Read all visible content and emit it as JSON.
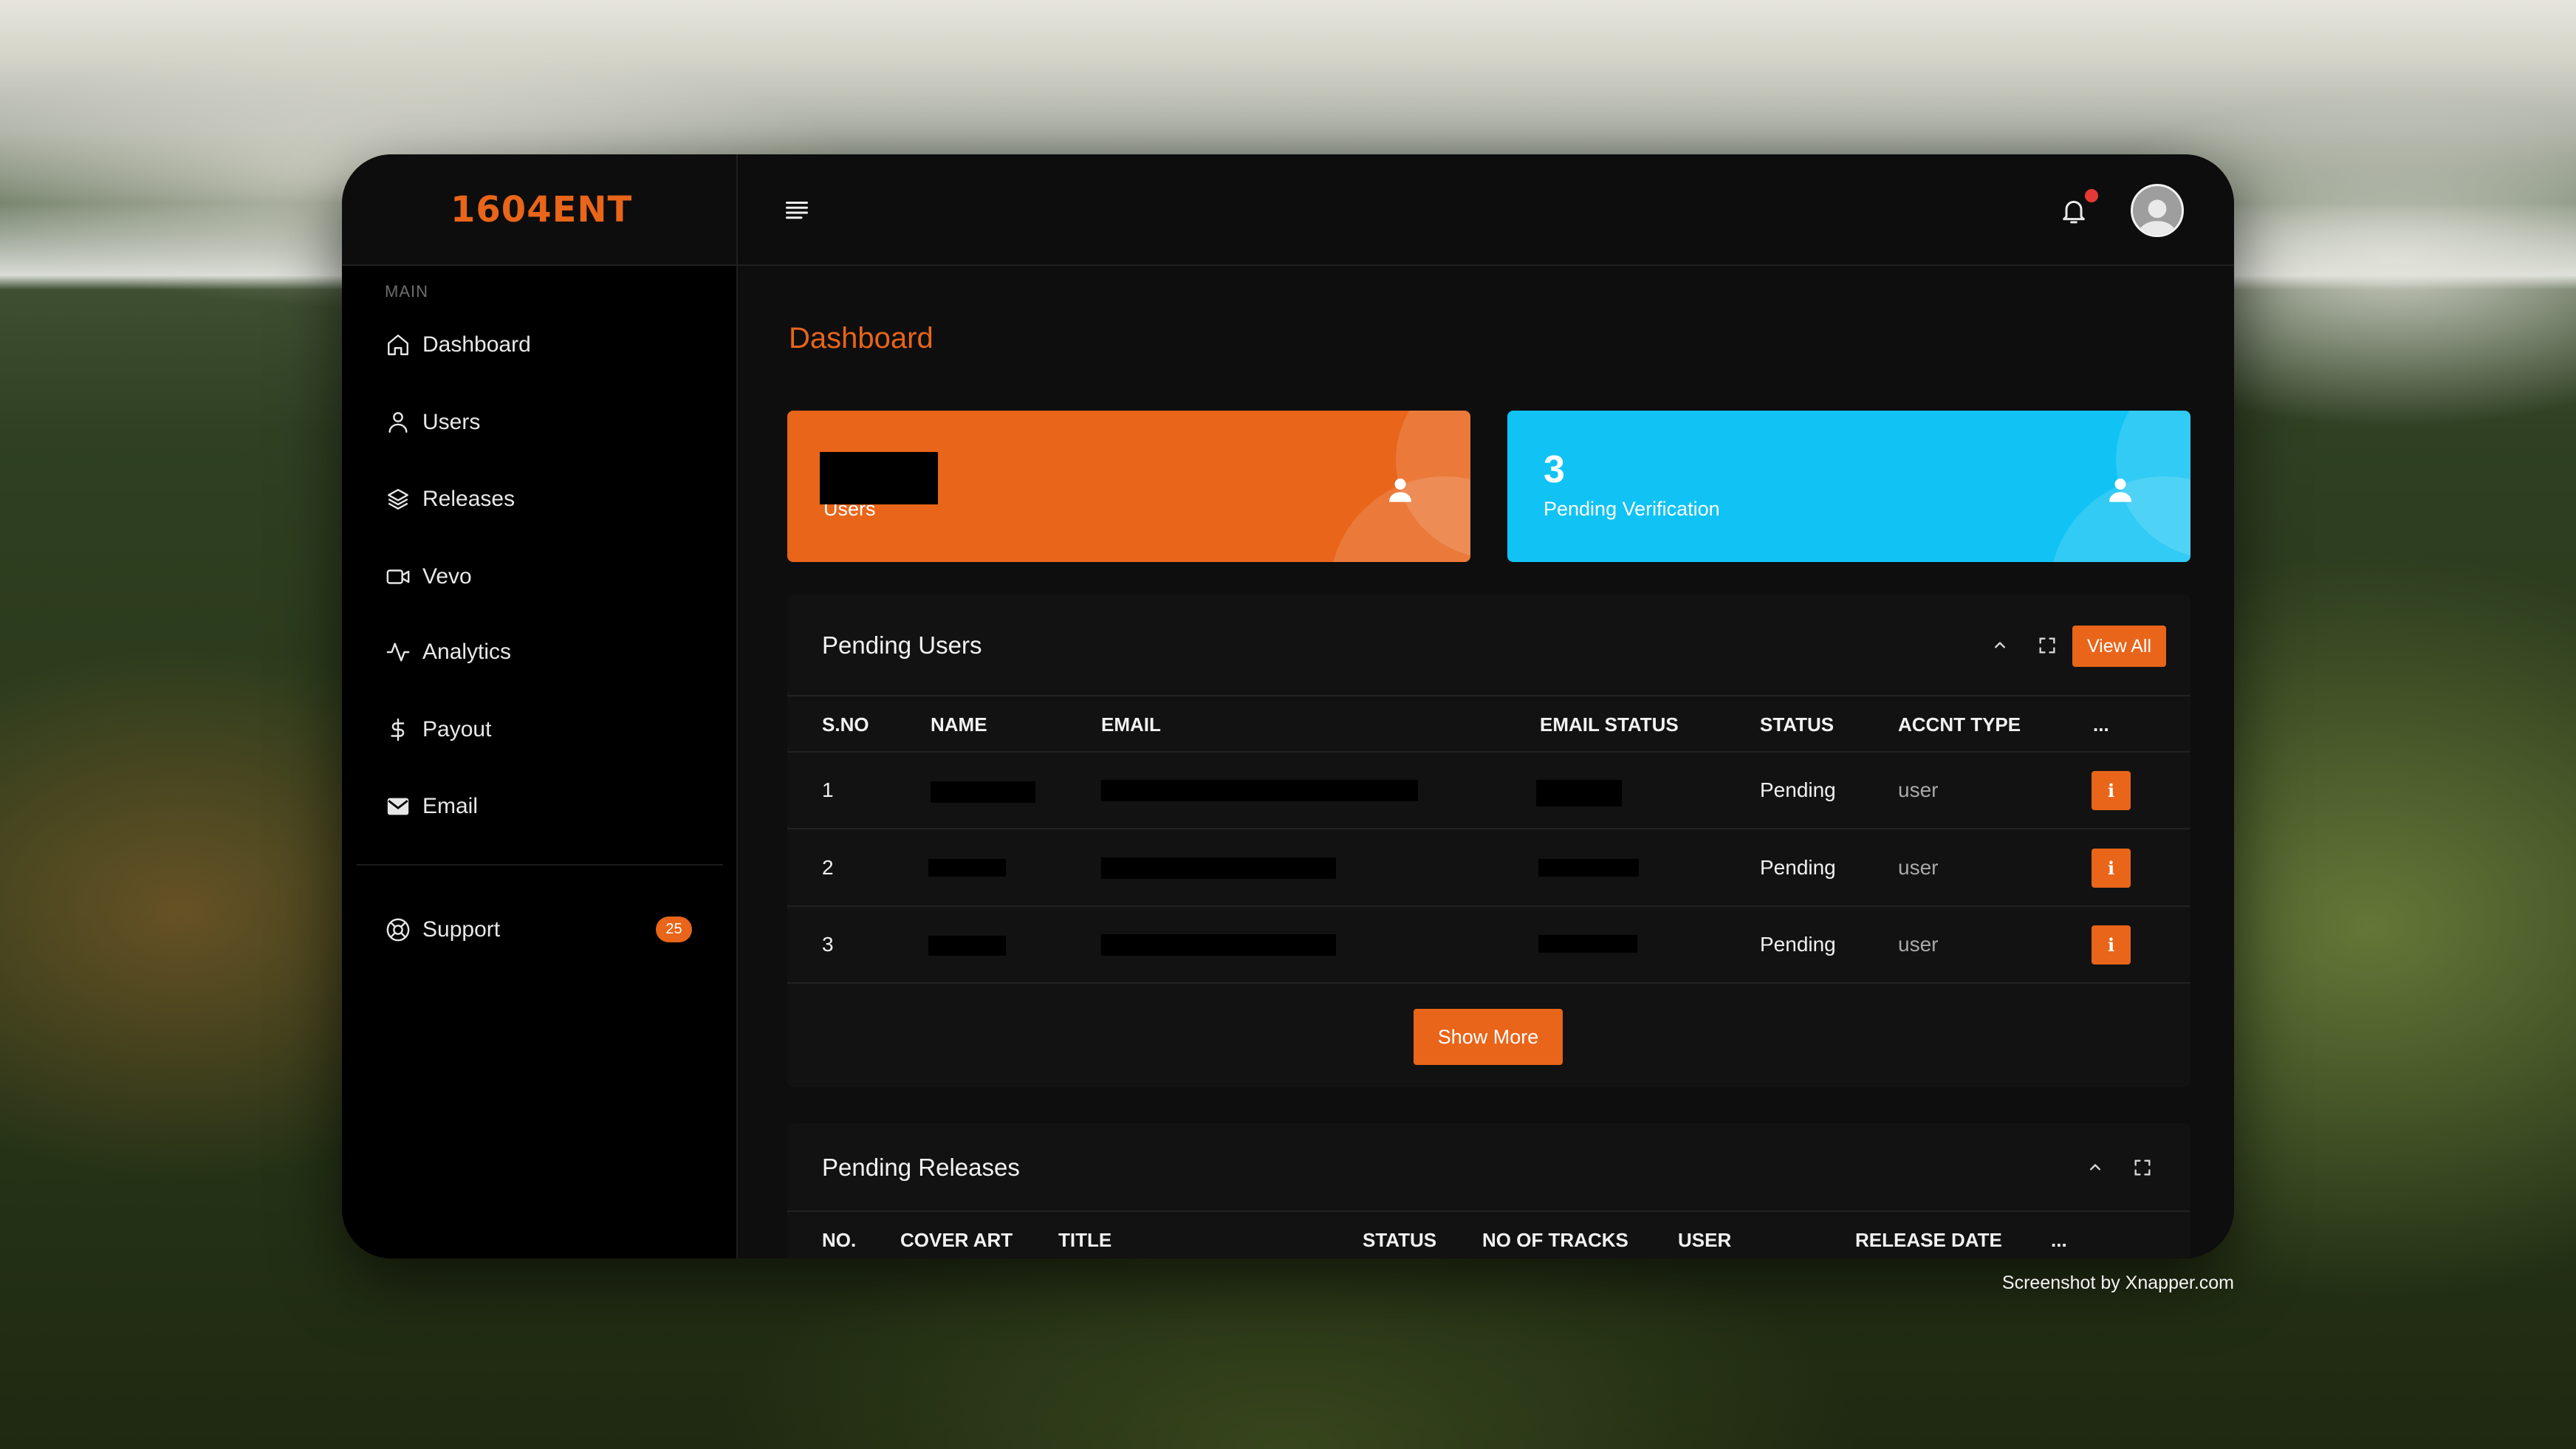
{
  "brand": {
    "logo": "1604ENT"
  },
  "header": {
    "menu_icon": "hamburger-icon",
    "notification_icon": "bell-icon",
    "profile_icon": "avatar-icon"
  },
  "sidebar": {
    "section_label": "MAIN",
    "items": [
      {
        "label": "Dashboard",
        "icon": "home-icon"
      },
      {
        "label": "Users",
        "icon": "user-icon"
      },
      {
        "label": "Releases",
        "icon": "layers-icon"
      },
      {
        "label": "Vevo",
        "icon": "video-icon"
      },
      {
        "label": "Analytics",
        "icon": "activity-icon"
      },
      {
        "label": "Payout",
        "icon": "dollar-icon"
      },
      {
        "label": "Email",
        "icon": "envelope-icon"
      }
    ],
    "support": {
      "label": "Support",
      "badge": "25",
      "icon": "lifebuoy-icon"
    }
  },
  "page": {
    "title": "Dashboard"
  },
  "stats": [
    {
      "label": "Users",
      "icon": "user-icon",
      "color": "#e8651a"
    },
    {
      "value": "3",
      "label": "Pending Verification",
      "icon": "user-icon",
      "color": "#10c3f4"
    }
  ],
  "pending_users": {
    "title": "Pending Users",
    "view_all_label": "View All",
    "columns": [
      "S.NO",
      "NAME",
      "EMAIL",
      "EMAIL STATUS",
      "STATUS",
      "ACCNT TYPE",
      "..."
    ],
    "rows": [
      {
        "sno": "1",
        "status": "Pending",
        "type": "user"
      },
      {
        "sno": "2",
        "status": "Pending",
        "type": "user"
      },
      {
        "sno": "3",
        "status": "Pending",
        "type": "user"
      }
    ],
    "row_action_label": "i",
    "show_more_label": "Show More"
  },
  "pending_releases": {
    "title": "Pending Releases",
    "columns": [
      "NO.",
      "COVER ART",
      "TITLE",
      "STATUS",
      "NO OF TRACKS",
      "USER",
      "RELEASE DATE",
      "..."
    ]
  },
  "watermark": "Screenshot by Xnapper.com",
  "colors": {
    "accent": "#e8651a",
    "info": "#10c3f4",
    "notification_dot": "#e53935",
    "sidebar_bg": "#000000",
    "panel_bg": "#121212"
  }
}
